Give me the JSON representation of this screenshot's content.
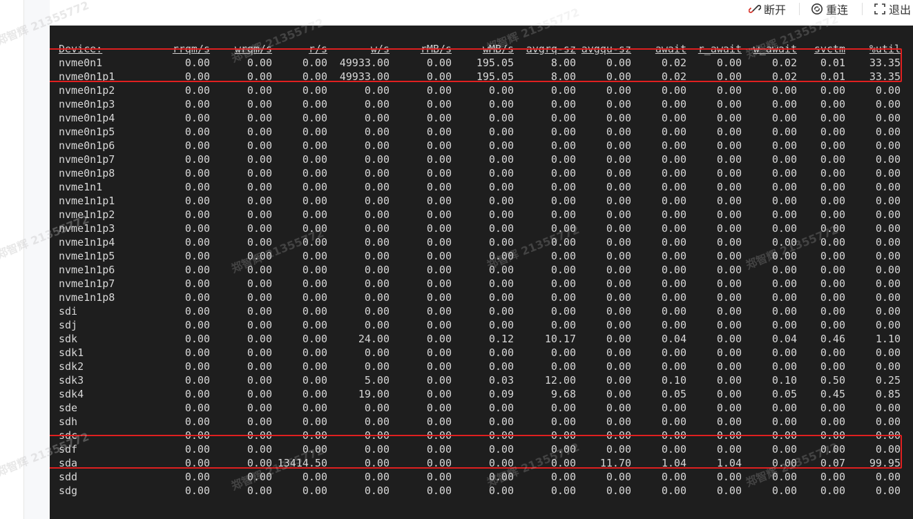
{
  "toolbar": {
    "disconnect_label": "断开",
    "reconnect_label": "重连",
    "exit_label": "退出"
  },
  "watermark": "郑智辉 21355772",
  "terminal": {
    "columns": [
      "Device:",
      "rrqm/s",
      "wrqm/s",
      "r/s",
      "w/s",
      "rMB/s",
      "wMB/s",
      "avgrq-sz",
      "avgqu-sz",
      "await",
      "r_await",
      "w_await",
      "svctm",
      "%util"
    ],
    "rows": [
      [
        "nvme0n1",
        "0.00",
        "0.00",
        "0.00",
        "49933.00",
        "0.00",
        "195.05",
        "8.00",
        "0.00",
        "0.02",
        "0.00",
        "0.02",
        "0.01",
        "33.35"
      ],
      [
        "nvme0n1p1",
        "0.00",
        "0.00",
        "0.00",
        "49933.00",
        "0.00",
        "195.05",
        "8.00",
        "0.00",
        "0.02",
        "0.00",
        "0.02",
        "0.01",
        "33.35"
      ],
      [
        "nvme0n1p2",
        "0.00",
        "0.00",
        "0.00",
        "0.00",
        "0.00",
        "0.00",
        "0.00",
        "0.00",
        "0.00",
        "0.00",
        "0.00",
        "0.00",
        "0.00"
      ],
      [
        "nvme0n1p3",
        "0.00",
        "0.00",
        "0.00",
        "0.00",
        "0.00",
        "0.00",
        "0.00",
        "0.00",
        "0.00",
        "0.00",
        "0.00",
        "0.00",
        "0.00"
      ],
      [
        "nvme0n1p4",
        "0.00",
        "0.00",
        "0.00",
        "0.00",
        "0.00",
        "0.00",
        "0.00",
        "0.00",
        "0.00",
        "0.00",
        "0.00",
        "0.00",
        "0.00"
      ],
      [
        "nvme0n1p5",
        "0.00",
        "0.00",
        "0.00",
        "0.00",
        "0.00",
        "0.00",
        "0.00",
        "0.00",
        "0.00",
        "0.00",
        "0.00",
        "0.00",
        "0.00"
      ],
      [
        "nvme0n1p6",
        "0.00",
        "0.00",
        "0.00",
        "0.00",
        "0.00",
        "0.00",
        "0.00",
        "0.00",
        "0.00",
        "0.00",
        "0.00",
        "0.00",
        "0.00"
      ],
      [
        "nvme0n1p7",
        "0.00",
        "0.00",
        "0.00",
        "0.00",
        "0.00",
        "0.00",
        "0.00",
        "0.00",
        "0.00",
        "0.00",
        "0.00",
        "0.00",
        "0.00"
      ],
      [
        "nvme0n1p8",
        "0.00",
        "0.00",
        "0.00",
        "0.00",
        "0.00",
        "0.00",
        "0.00",
        "0.00",
        "0.00",
        "0.00",
        "0.00",
        "0.00",
        "0.00"
      ],
      [
        "nvme1n1",
        "0.00",
        "0.00",
        "0.00",
        "0.00",
        "0.00",
        "0.00",
        "0.00",
        "0.00",
        "0.00",
        "0.00",
        "0.00",
        "0.00",
        "0.00"
      ],
      [
        "nvme1n1p1",
        "0.00",
        "0.00",
        "0.00",
        "0.00",
        "0.00",
        "0.00",
        "0.00",
        "0.00",
        "0.00",
        "0.00",
        "0.00",
        "0.00",
        "0.00"
      ],
      [
        "nvme1n1p2",
        "0.00",
        "0.00",
        "0.00",
        "0.00",
        "0.00",
        "0.00",
        "0.00",
        "0.00",
        "0.00",
        "0.00",
        "0.00",
        "0.00",
        "0.00"
      ],
      [
        "nvme1n1p3",
        "0.00",
        "0.00",
        "0.00",
        "0.00",
        "0.00",
        "0.00",
        "0.00",
        "0.00",
        "0.00",
        "0.00",
        "0.00",
        "0.00",
        "0.00"
      ],
      [
        "nvme1n1p4",
        "0.00",
        "0.00",
        "0.00",
        "0.00",
        "0.00",
        "0.00",
        "0.00",
        "0.00",
        "0.00",
        "0.00",
        "0.00",
        "0.00",
        "0.00"
      ],
      [
        "nvme1n1p5",
        "0.00",
        "0.00",
        "0.00",
        "0.00",
        "0.00",
        "0.00",
        "0.00",
        "0.00",
        "0.00",
        "0.00",
        "0.00",
        "0.00",
        "0.00"
      ],
      [
        "nvme1n1p6",
        "0.00",
        "0.00",
        "0.00",
        "0.00",
        "0.00",
        "0.00",
        "0.00",
        "0.00",
        "0.00",
        "0.00",
        "0.00",
        "0.00",
        "0.00"
      ],
      [
        "nvme1n1p7",
        "0.00",
        "0.00",
        "0.00",
        "0.00",
        "0.00",
        "0.00",
        "0.00",
        "0.00",
        "0.00",
        "0.00",
        "0.00",
        "0.00",
        "0.00"
      ],
      [
        "nvme1n1p8",
        "0.00",
        "0.00",
        "0.00",
        "0.00",
        "0.00",
        "0.00",
        "0.00",
        "0.00",
        "0.00",
        "0.00",
        "0.00",
        "0.00",
        "0.00"
      ],
      [
        "sdi",
        "0.00",
        "0.00",
        "0.00",
        "0.00",
        "0.00",
        "0.00",
        "0.00",
        "0.00",
        "0.00",
        "0.00",
        "0.00",
        "0.00",
        "0.00"
      ],
      [
        "sdj",
        "0.00",
        "0.00",
        "0.00",
        "0.00",
        "0.00",
        "0.00",
        "0.00",
        "0.00",
        "0.00",
        "0.00",
        "0.00",
        "0.00",
        "0.00"
      ],
      [
        "sdk",
        "0.00",
        "0.00",
        "0.00",
        "24.00",
        "0.00",
        "0.12",
        "10.17",
        "0.00",
        "0.04",
        "0.00",
        "0.04",
        "0.46",
        "1.10"
      ],
      [
        "sdk1",
        "0.00",
        "0.00",
        "0.00",
        "0.00",
        "0.00",
        "0.00",
        "0.00",
        "0.00",
        "0.00",
        "0.00",
        "0.00",
        "0.00",
        "0.00"
      ],
      [
        "sdk2",
        "0.00",
        "0.00",
        "0.00",
        "0.00",
        "0.00",
        "0.00",
        "0.00",
        "0.00",
        "0.00",
        "0.00",
        "0.00",
        "0.00",
        "0.00"
      ],
      [
        "sdk3",
        "0.00",
        "0.00",
        "0.00",
        "5.00",
        "0.00",
        "0.03",
        "12.00",
        "0.00",
        "0.10",
        "0.00",
        "0.10",
        "0.50",
        "0.25"
      ],
      [
        "sdk4",
        "0.00",
        "0.00",
        "0.00",
        "19.00",
        "0.00",
        "0.09",
        "9.68",
        "0.00",
        "0.05",
        "0.00",
        "0.05",
        "0.45",
        "0.85"
      ],
      [
        "sde",
        "0.00",
        "0.00",
        "0.00",
        "0.00",
        "0.00",
        "0.00",
        "0.00",
        "0.00",
        "0.00",
        "0.00",
        "0.00",
        "0.00",
        "0.00"
      ],
      [
        "sdh",
        "0.00",
        "0.00",
        "0.00",
        "0.00",
        "0.00",
        "0.00",
        "0.00",
        "0.00",
        "0.00",
        "0.00",
        "0.00",
        "0.00",
        "0.00"
      ],
      [
        "sdc",
        "0.00",
        "0.00",
        "0.00",
        "0.00",
        "0.00",
        "0.00",
        "0.00",
        "0.00",
        "0.00",
        "0.00",
        "0.00",
        "0.00",
        "0.00"
      ],
      [
        "sdf",
        "0.00",
        "0.00",
        "0.00",
        "0.00",
        "0.00",
        "0.00",
        "0.00",
        "0.00",
        "0.00",
        "0.00",
        "0.00",
        "0.00",
        "0.00"
      ],
      [
        "sda",
        "0.00",
        "0.00",
        "13414.50",
        "0.00",
        "0.00",
        "0.00",
        "0.00",
        "11.70",
        "1.04",
        "1.04",
        "0.00",
        "0.07",
        "99.95"
      ],
      [
        "sdd",
        "0.00",
        "0.00",
        "0.00",
        "0.00",
        "0.00",
        "0.00",
        "0.00",
        "0.00",
        "0.00",
        "0.00",
        "0.00",
        "0.00",
        "0.00"
      ],
      [
        "sdg",
        "0.00",
        "0.00",
        "0.00",
        "0.00",
        "0.00",
        "0.00",
        "0.00",
        "0.00",
        "0.00",
        "0.00",
        "0.00",
        "0.00",
        "0.00"
      ]
    ]
  },
  "colors": {
    "terminal_bg": "#1e1e1e",
    "terminal_fg": "#d8d8d8",
    "highlight": "#e02020"
  }
}
